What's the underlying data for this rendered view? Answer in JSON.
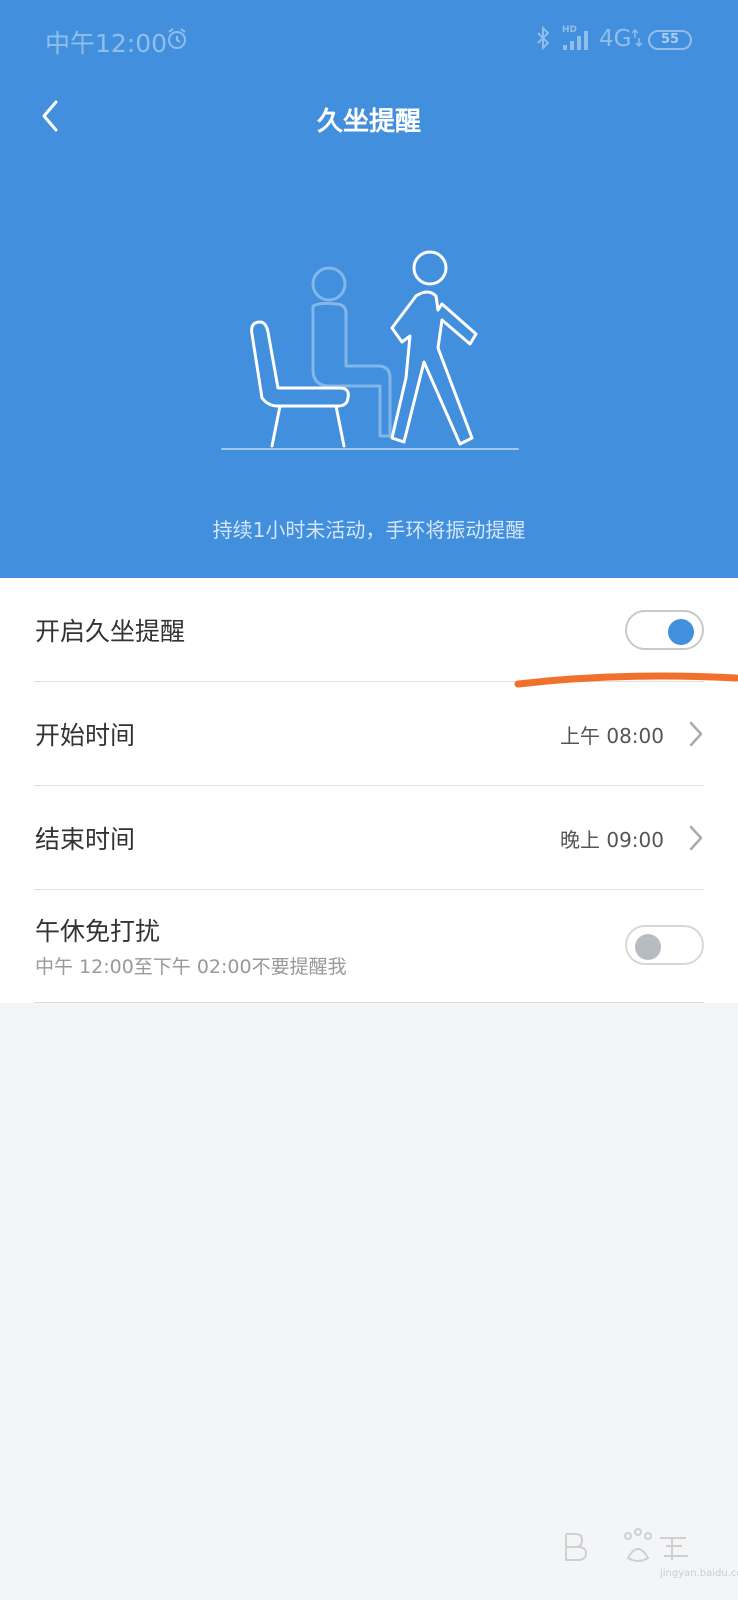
{
  "status_bar": {
    "time": "中午12:00",
    "signal_tag": "HD",
    "network": "4G",
    "battery": "55",
    "icons": [
      "alarm-icon",
      "bluetooth-icon",
      "signal-icon",
      "data-arrows-icon",
      "battery-icon"
    ]
  },
  "header": {
    "title": "久坐提醒",
    "back_icon": "chevron-left-icon"
  },
  "hero": {
    "illustration": "chair-sitting-walking-person-icon",
    "description": "持续1小时未活动，手环将振动提醒"
  },
  "settings": {
    "enable": {
      "label": "开启久坐提醒",
      "on": true
    },
    "start_time": {
      "label": "开始时间",
      "value": "上午 08:00"
    },
    "end_time": {
      "label": "结束时间",
      "value": "晚上 09:00"
    },
    "nap": {
      "label": "午休免打扰",
      "sublabel": "中午 12:00至下午 02:00不要提醒我",
      "on": false
    }
  },
  "watermark": {
    "text": "jingyan.baidu.com"
  },
  "colors": {
    "primary": "#418fdd",
    "annotation": "#f0712a",
    "page_background": "#f4f5f7"
  }
}
